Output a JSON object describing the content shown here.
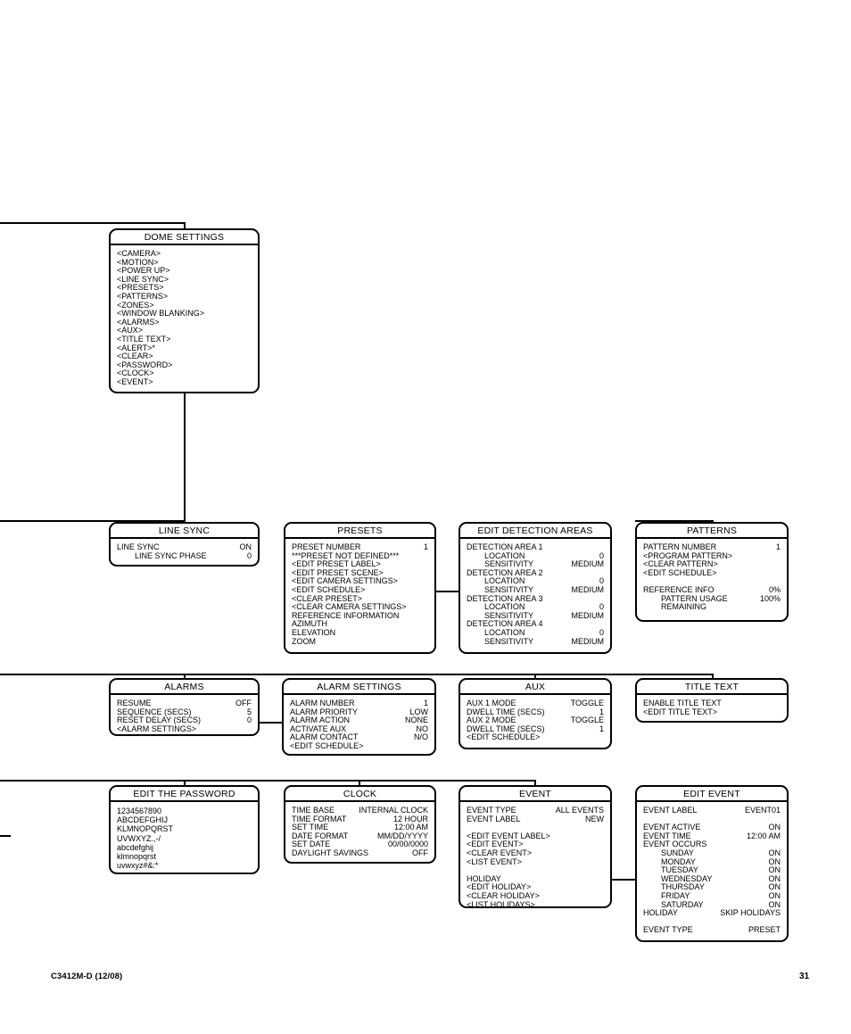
{
  "footer": {
    "doc_id": "C3412M-D (12/08)",
    "page_number": "31"
  },
  "boxes": {
    "dome_settings": {
      "title": "DOME SETTINGS",
      "items": [
        "<CAMERA>",
        "<MOTION>",
        "<POWER UP>",
        "<LINE SYNC>",
        "<PRESETS>",
        "<PATTERNS>",
        "<ZONES>",
        "<WINDOW BLANKING>",
        "<ALARMS>",
        "<AUX>",
        "<TITLE TEXT>",
        "<ALERT>*",
        "<CLEAR>",
        "<PASSWORD>",
        "<CLOCK>",
        "<EVENT>"
      ]
    },
    "line_sync": {
      "title": "LINE SYNC",
      "rows": [
        {
          "label": "LINE SYNC",
          "value": "ON",
          "indent": 0
        },
        {
          "label": "LINE SYNC PHASE",
          "value": "0",
          "indent": 1
        }
      ]
    },
    "presets": {
      "title": "PRESETS",
      "rows": [
        {
          "label": "PRESET NUMBER",
          "value": "1",
          "indent": 0
        },
        {
          "label": "***PRESET NOT DEFINED***",
          "value": "",
          "indent": 0
        },
        {
          "label": "<EDIT PRESET LABEL>",
          "value": "",
          "indent": 0
        },
        {
          "label": "<EDIT PRESET SCENE>",
          "value": "",
          "indent": 0
        },
        {
          "label": "<EDIT CAMERA SETTINGS>",
          "value": "",
          "indent": 0
        },
        {
          "label": "<EDIT SCHEDULE>",
          "value": "",
          "indent": 0
        },
        {
          "label": "<CLEAR PRESET>",
          "value": "",
          "indent": 0
        },
        {
          "label": "<CLEAR CAMERA SETTINGS>",
          "value": "",
          "indent": 0
        },
        {
          "label": "REFERENCE INFORMATION",
          "value": "",
          "indent": 0
        },
        {
          "label": "AZIMUTH",
          "value": "",
          "indent": 0
        },
        {
          "label": "ELEVATION",
          "value": "",
          "indent": 0
        },
        {
          "label": "ZOOM",
          "value": "",
          "indent": 0
        }
      ]
    },
    "edit_detection_areas": {
      "title": "EDIT DETECTION AREAS",
      "rows": [
        {
          "label": "DETECTION AREA 1",
          "value": "",
          "indent": 0
        },
        {
          "label": "LOCATION",
          "value": "0",
          "indent": 1
        },
        {
          "label": "SENSITIVITY",
          "value": "MEDIUM",
          "indent": 1
        },
        {
          "label": "DETECTION AREA 2",
          "value": "",
          "indent": 0
        },
        {
          "label": "LOCATION",
          "value": "0",
          "indent": 1
        },
        {
          "label": "SENSITIVITY",
          "value": "MEDIUM",
          "indent": 1
        },
        {
          "label": "DETECTION AREA 3",
          "value": "",
          "indent": 0
        },
        {
          "label": "LOCATION",
          "value": "0",
          "indent": 1
        },
        {
          "label": "SENSITIVITY",
          "value": "MEDIUM",
          "indent": 1
        },
        {
          "label": "DETECTION AREA 4",
          "value": "",
          "indent": 0
        },
        {
          "label": "LOCATION",
          "value": "0",
          "indent": 1
        },
        {
          "label": "SENSITIVITY",
          "value": "MEDIUM",
          "indent": 1
        }
      ]
    },
    "patterns": {
      "title": "PATTERNS",
      "rows": [
        {
          "label": "PATTERN NUMBER",
          "value": "1",
          "indent": 0
        },
        {
          "label": "<PROGRAM PATTERN>",
          "value": "",
          "indent": 0
        },
        {
          "label": "<CLEAR PATTERN>",
          "value": "",
          "indent": 0
        },
        {
          "label": "<EDIT SCHEDULE>",
          "value": "",
          "indent": 0
        },
        {
          "label": "",
          "value": "",
          "indent": 0,
          "spacer": true
        },
        {
          "label": "REFERENCE INFO",
          "value": "0%",
          "indent": 0
        },
        {
          "label": "PATTERN USAGE",
          "value": "100%",
          "indent": 1
        },
        {
          "label": "REMAINING",
          "value": "",
          "indent": 1
        }
      ]
    },
    "alarms": {
      "title": "ALARMS",
      "rows": [
        {
          "label": "RESUME",
          "value": "OFF",
          "indent": 0
        },
        {
          "label": "SEQUENCE (SECS)",
          "value": "5",
          "indent": 0
        },
        {
          "label": "RESET DELAY (SECS)",
          "value": "0",
          "indent": 0
        },
        {
          "label": "<ALARM SETTINGS>",
          "value": "",
          "indent": 0
        }
      ]
    },
    "alarm_settings": {
      "title": "ALARM SETTINGS",
      "rows": [
        {
          "label": "ALARM NUMBER",
          "value": "1",
          "indent": 0
        },
        {
          "label": "ALARM PRIORITY",
          "value": "LOW",
          "indent": 0
        },
        {
          "label": "ALARM ACTION",
          "value": "NONE",
          "indent": 0
        },
        {
          "label": "ACTIVATE AUX",
          "value": "NO",
          "indent": 0
        },
        {
          "label": "ALARM CONTACT",
          "value": "N/O",
          "indent": 0
        },
        {
          "label": "<EDIT SCHEDULE>",
          "value": "",
          "indent": 0
        }
      ]
    },
    "aux": {
      "title": "AUX",
      "rows": [
        {
          "label": "AUX 1 MODE",
          "value": "TOGGLE",
          "indent": 0
        },
        {
          "label": "DWELL TIME (SECS)",
          "value": "1",
          "indent": 0
        },
        {
          "label": "AUX 2 MODE",
          "value": "TOGGLE",
          "indent": 0
        },
        {
          "label": "DWELL TIME (SECS)",
          "value": "1",
          "indent": 0
        },
        {
          "label": "<EDIT SCHEDULE>",
          "value": "",
          "indent": 0
        }
      ]
    },
    "title_text": {
      "title": "TITLE TEXT",
      "rows": [
        {
          "label": "ENABLE TITLE TEXT",
          "value": "",
          "indent": 0
        },
        {
          "label": "<EDIT TITLE TEXT>",
          "value": "",
          "indent": 0
        }
      ]
    },
    "edit_the_password": {
      "title": "EDIT THE PASSWORD",
      "charlines": [
        "1234567890",
        "ABCDEFGHIJ",
        "KLMNOPQRST",
        "UVWXYZ.,-/",
        "abcdefghij",
        "klmnopqrst",
        "uvwxyz#&:*"
      ]
    },
    "clock": {
      "title": "CLOCK",
      "rows": [
        {
          "label": "TIME BASE",
          "value": "INTERNAL CLOCK",
          "indent": 0
        },
        {
          "label": "TIME FORMAT",
          "value": "12 HOUR",
          "indent": 0
        },
        {
          "label": "SET TIME",
          "value": "12:00 AM",
          "indent": 0
        },
        {
          "label": "DATE FORMAT",
          "value": "MM/DD/YYYY",
          "indent": 0
        },
        {
          "label": "SET DATE",
          "value": "00/00/0000",
          "indent": 0
        },
        {
          "label": "DAYLIGHT SAVINGS",
          "value": "OFF",
          "indent": 0
        }
      ]
    },
    "event": {
      "title": "EVENT",
      "rows": [
        {
          "label": "EVENT TYPE",
          "value": "ALL EVENTS",
          "indent": 0
        },
        {
          "label": "EVENT LABEL",
          "value": "NEW",
          "indent": 0
        },
        {
          "label": "",
          "value": "",
          "indent": 0,
          "spacer": true
        },
        {
          "label": "<EDIT EVENT LABEL>",
          "value": "",
          "indent": 0
        },
        {
          "label": "<EDIT EVENT>",
          "value": "",
          "indent": 0
        },
        {
          "label": "<CLEAR EVENT>",
          "value": "",
          "indent": 0
        },
        {
          "label": "<LIST EVENT>",
          "value": "",
          "indent": 0
        },
        {
          "label": "",
          "value": "",
          "indent": 0,
          "spacer": true
        },
        {
          "label": "HOLIDAY",
          "value": "",
          "indent": 0
        },
        {
          "label": "<EDIT HOLIDAY>",
          "value": "",
          "indent": 0
        },
        {
          "label": "<CLEAR HOLIDAY>",
          "value": "",
          "indent": 0
        },
        {
          "label": "<LIST HOLIDAYS>",
          "value": "",
          "indent": 0
        }
      ]
    },
    "edit_event": {
      "title": "EDIT EVENT",
      "rows": [
        {
          "label": "EVENT LABEL",
          "value": "EVENT01",
          "indent": 0
        },
        {
          "label": "",
          "value": "",
          "indent": 0,
          "spacer": true
        },
        {
          "label": "EVENT ACTIVE",
          "value": "ON",
          "indent": 0
        },
        {
          "label": "EVENT TIME",
          "value": "12:00 AM",
          "indent": 0
        },
        {
          "label": "EVENT OCCURS",
          "value": "",
          "indent": 0
        },
        {
          "label": "SUNDAY",
          "value": "ON",
          "indent": 1
        },
        {
          "label": "MONDAY",
          "value": "ON",
          "indent": 1
        },
        {
          "label": "TUESDAY",
          "value": "ON",
          "indent": 1
        },
        {
          "label": "WEDNESDAY",
          "value": "ON",
          "indent": 1
        },
        {
          "label": "THURSDAY",
          "value": "ON",
          "indent": 1
        },
        {
          "label": "FRIDAY",
          "value": "ON",
          "indent": 1
        },
        {
          "label": "SATURDAY",
          "value": "ON",
          "indent": 1
        },
        {
          "label": "HOLIDAY",
          "value": "SKIP HOLIDAYS",
          "indent": 0
        },
        {
          "label": "",
          "value": "",
          "indent": 0,
          "spacer": true
        },
        {
          "label": "EVENT TYPE",
          "value": "PRESET",
          "indent": 0
        }
      ]
    }
  }
}
